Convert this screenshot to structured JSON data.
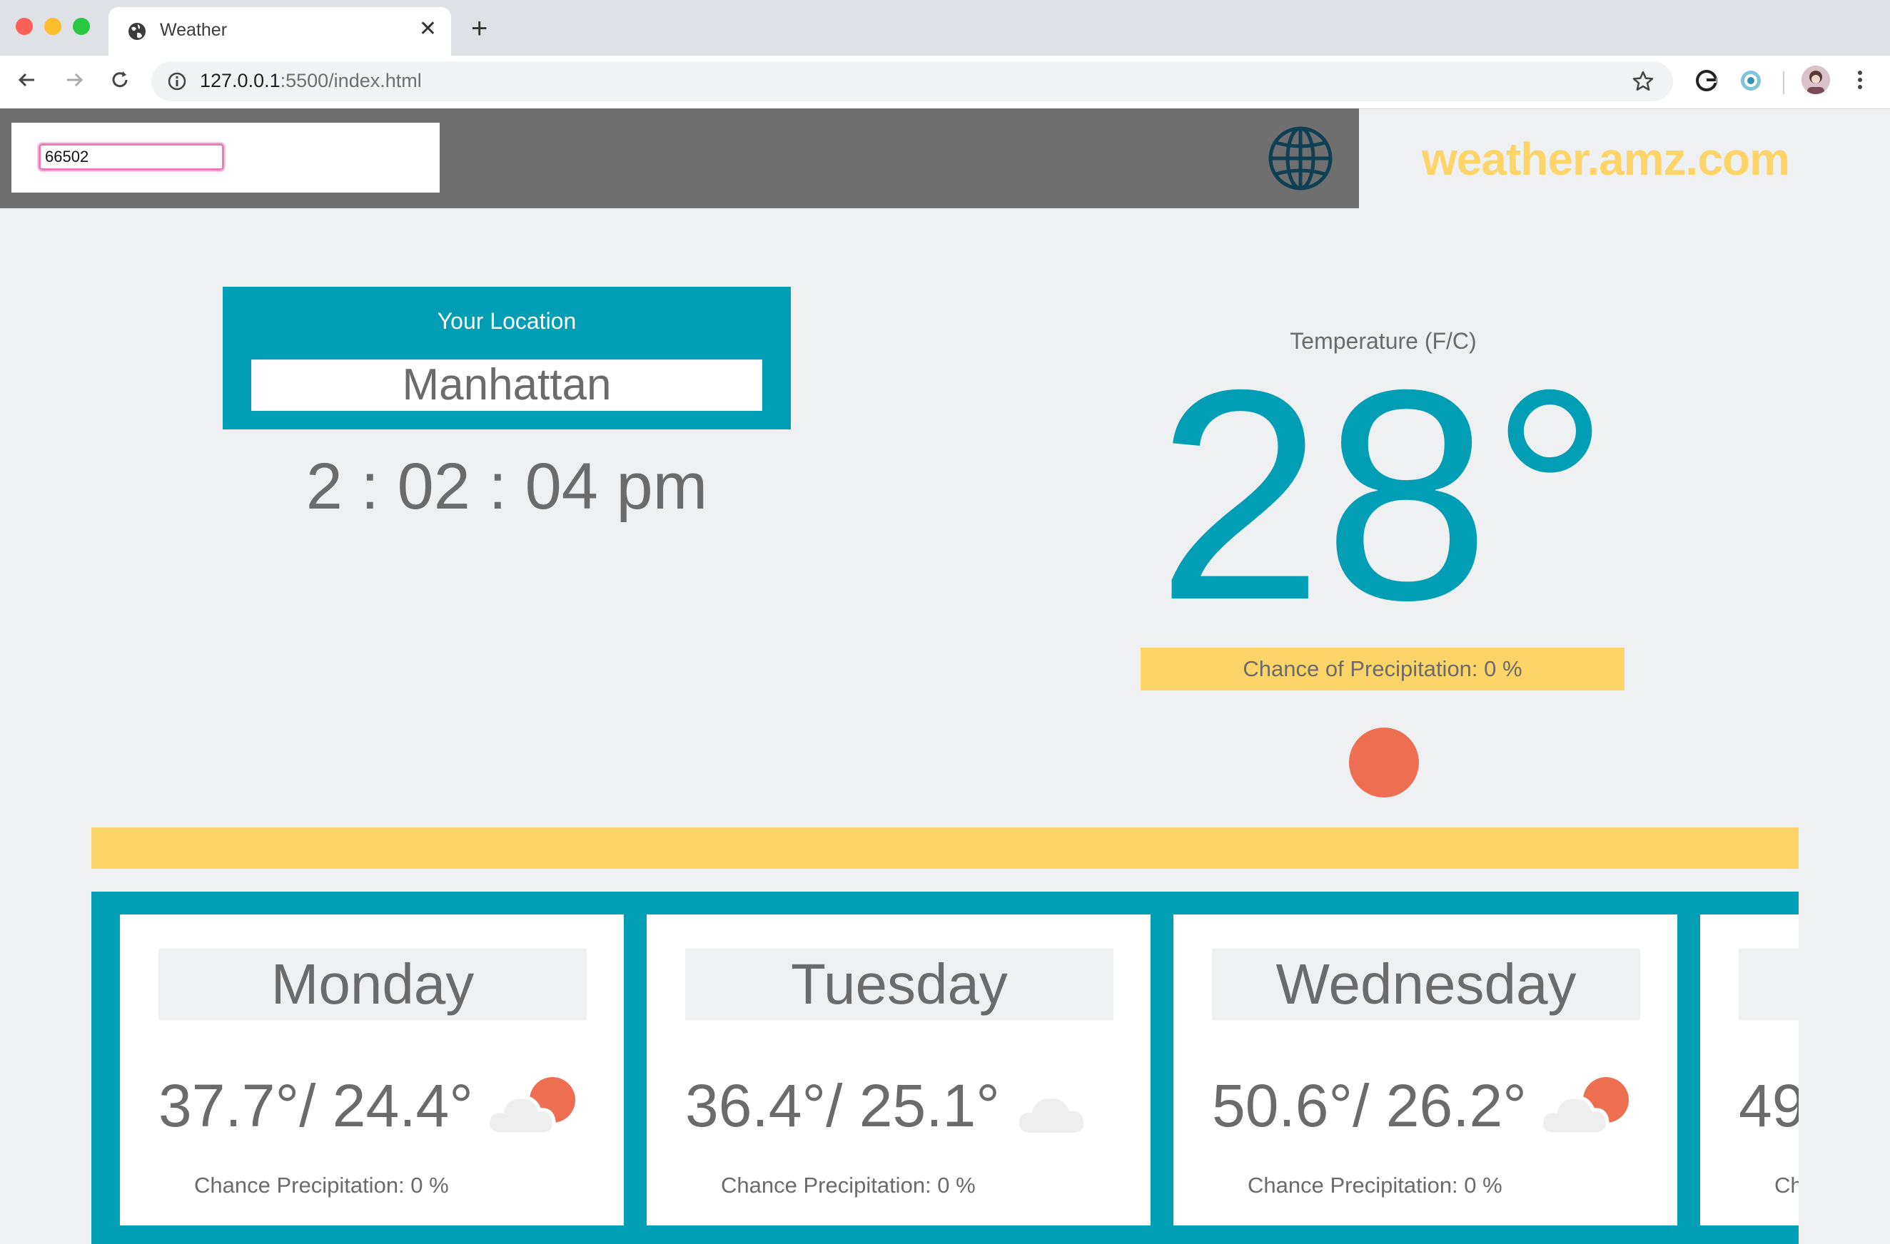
{
  "browser": {
    "tab_title": "Weather",
    "url_host": "127.0.0.1",
    "url_rest": ":5500/index.html"
  },
  "header": {
    "search_value": "66502",
    "brand": "weather.amz.com"
  },
  "location": {
    "label": "Your Location",
    "city": "Manhattan",
    "time": "2 : 02 : 04 pm"
  },
  "current": {
    "temp_label": "Temperature (F/C)",
    "temp_value": "28°",
    "precip": "Chance of Precipitation: 0 %",
    "icon": "sun-icon"
  },
  "forecast": [
    {
      "day": "Monday",
      "temps": "37.7°/ 24.4°",
      "precip": "Chance Precipitation: 0 %",
      "icon": "partly-cloudy-icon"
    },
    {
      "day": "Tuesday",
      "temps": "36.4°/ 25.1°",
      "precip": "Chance Precipitation: 0 %",
      "icon": "cloud-icon"
    },
    {
      "day": "Wednesday",
      "temps": "50.6°/ 26.2°",
      "precip": "Chance Precipitation: 0 %",
      "icon": "partly-cloudy-icon"
    },
    {
      "day": "",
      "temps": "49",
      "precip": "Ch",
      "icon": ""
    }
  ],
  "colors": {
    "teal": "#029eb6",
    "yellow": "#fdd468",
    "sun": "#ee6e51",
    "header_gray": "#6f6f6f",
    "background": "#eff0f2"
  }
}
